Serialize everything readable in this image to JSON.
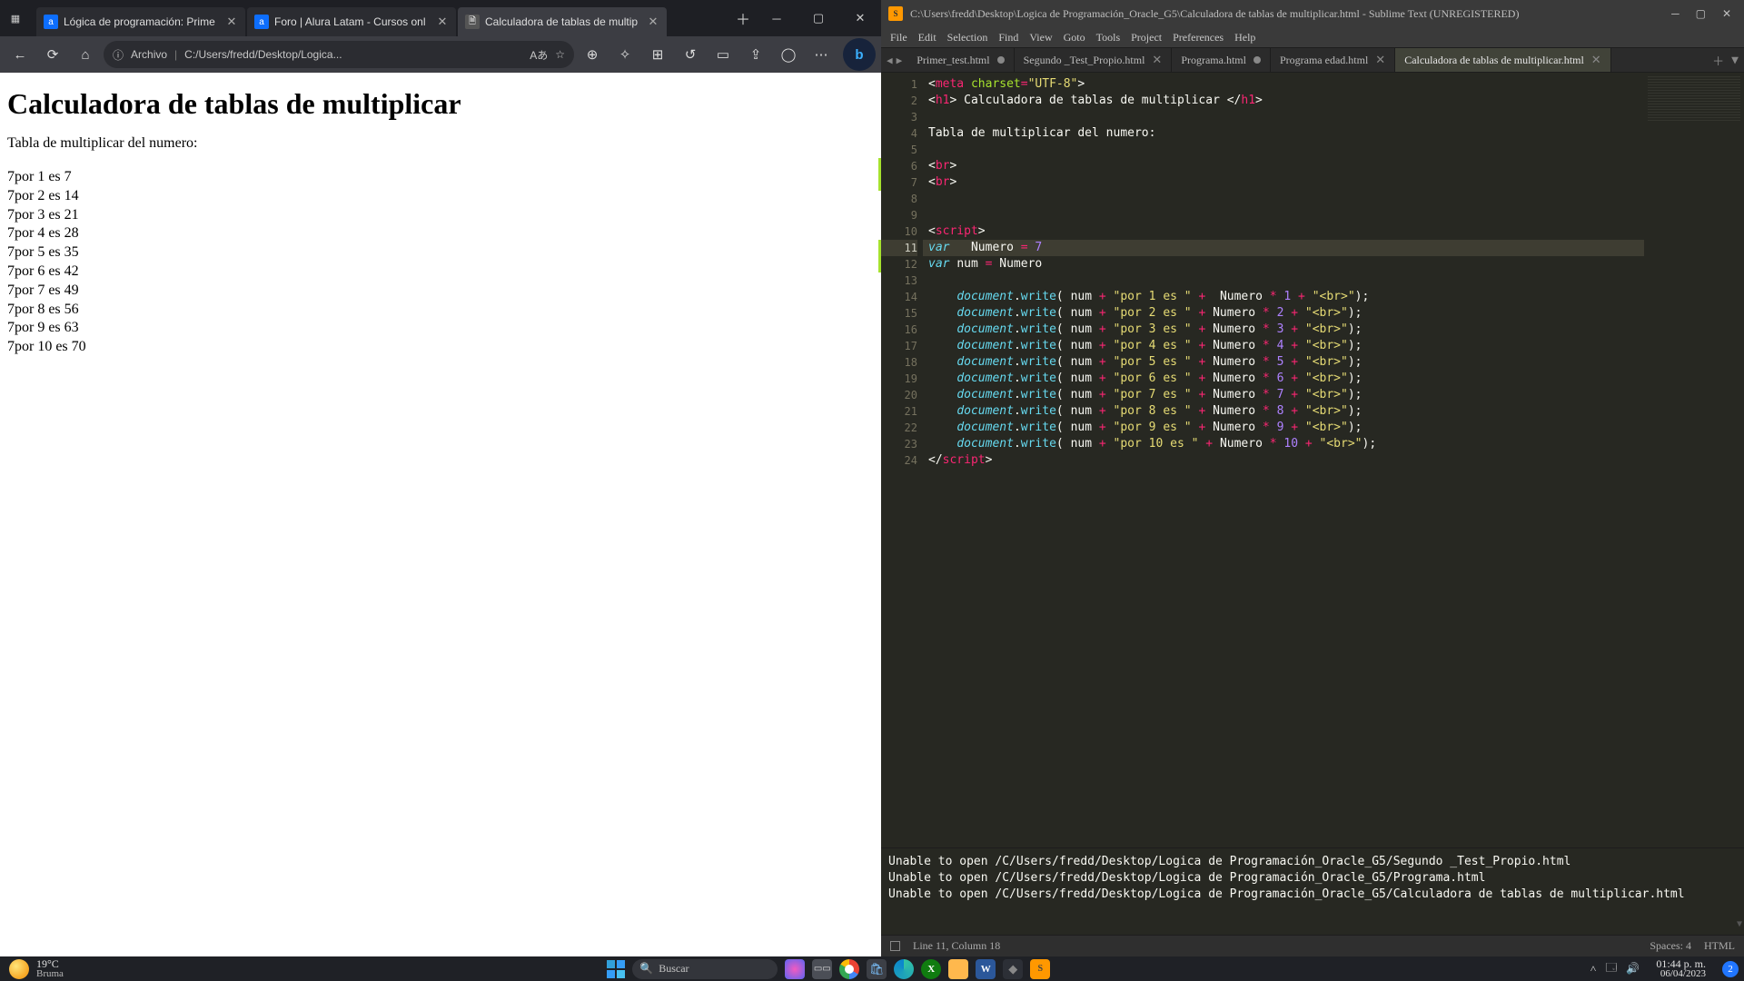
{
  "browser": {
    "tabs": [
      {
        "favType": "a",
        "fav": "a",
        "title": "Lógica de programación: Prime"
      },
      {
        "favType": "a",
        "fav": "a",
        "title": "Foro | Alura Latam - Cursos onl"
      },
      {
        "favType": "page",
        "fav": "🗎",
        "title": "Calculadora de tablas de multip"
      }
    ],
    "addr_label": "Archivo",
    "addr_path": "C:/Users/fredd/Desktop/Logica...",
    "page": {
      "h1": "Calculadora de tablas de multiplicar",
      "subtitle": "Tabla de multiplicar del numero:",
      "rows": [
        "7por 1 es 7",
        "7por 2 es 14",
        "7por 3 es 21",
        "7por 4 es 28",
        "7por 5 es 35",
        "7por 6 es 42",
        "7por 7 es 49",
        "7por 8 es 56",
        "7por 9 es 63",
        "7por 10 es 70"
      ]
    }
  },
  "sublime": {
    "titlebar": "C:\\Users\\fredd\\Desktop\\Logica de Programación_Oracle_G5\\Calculadora de tablas de multiplicar.html - Sublime Text (UNREGISTERED)",
    "menus": [
      "File",
      "Edit",
      "Selection",
      "Find",
      "View",
      "Goto",
      "Tools",
      "Project",
      "Preferences",
      "Help"
    ],
    "tabs": [
      {
        "title": "Primer_test.html",
        "dirty": true
      },
      {
        "title": "Segundo _Test_Propio.html",
        "dirty": false,
        "close": true
      },
      {
        "title": "Programa.html",
        "dirty": true
      },
      {
        "title": "Programa edad.html",
        "dirty": false,
        "close": true
      },
      {
        "title": "Calculadora de tablas de multiplicar.html",
        "dirty": false,
        "close": true,
        "active": true
      }
    ],
    "current_line": 11,
    "modified_lines": [
      6,
      7,
      11,
      12
    ],
    "console": "Unable to open /C/Users/fredd/Desktop/Logica de Programación_Oracle_G5/Segundo _Test_Propio.html\nUnable to open /C/Users/fredd/Desktop/Logica de Programación_Oracle_G5/Programa.html\nUnable to open /C/Users/fredd/Desktop/Logica de Programación_Oracle_G5/Calculadora de tablas de multiplicar.html",
    "status_left": "Line 11, Column 18",
    "status_spaces": "Spaces: 4",
    "status_lang": "HTML"
  },
  "taskbar": {
    "temp": "19°C",
    "cond": "Bruma",
    "search": "Buscar",
    "time": "01:44 p. m.",
    "date": "06/04/2023",
    "bell": "2"
  }
}
